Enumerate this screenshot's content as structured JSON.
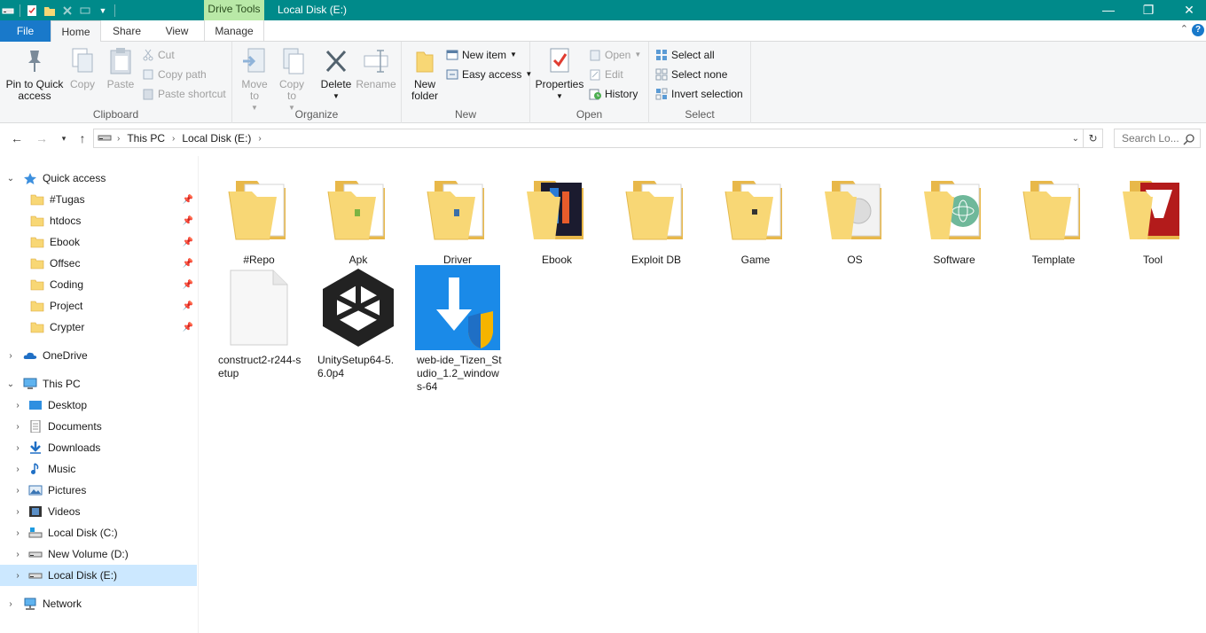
{
  "titlebar": {
    "context_tab": "Drive Tools",
    "title": "Local Disk (E:)",
    "controls": {
      "minimize": "—",
      "restore": "❐",
      "close": "✕"
    }
  },
  "tabs": {
    "file": "File",
    "home": "Home",
    "share": "Share",
    "view": "View",
    "manage": "Manage",
    "collapse": "⌃",
    "help": "?"
  },
  "ribbon": {
    "clipboard": {
      "label": "Clipboard",
      "pin": "Pin to Quick access",
      "copy": "Copy",
      "paste": "Paste",
      "cut": "Cut",
      "copy_path": "Copy path",
      "paste_shortcut": "Paste shortcut"
    },
    "organize": {
      "label": "Organize",
      "move_to": "Move to",
      "copy_to": "Copy to",
      "delete": "Delete",
      "rename": "Rename"
    },
    "new": {
      "label": "New",
      "new_folder": "New folder",
      "new_item": "New item",
      "easy_access": "Easy access"
    },
    "open": {
      "label": "Open",
      "properties": "Properties",
      "open": "Open",
      "edit": "Edit",
      "history": "History"
    },
    "select": {
      "label": "Select",
      "select_all": "Select all",
      "select_none": "Select none",
      "invert_selection": "Invert selection"
    }
  },
  "address": {
    "crumbs": [
      "This PC",
      "Local Disk (E:)"
    ],
    "search_placeholder": "Search Lo..."
  },
  "sidebar": {
    "quick_access": "Quick access",
    "pinned": [
      "#Tugas",
      "htdocs",
      "Ebook",
      "Offsec",
      "Coding",
      "Project",
      "Crypter"
    ],
    "onedrive": "OneDrive",
    "this_pc": "This PC",
    "pc_items": [
      "Desktop",
      "Documents",
      "Downloads",
      "Music",
      "Pictures",
      "Videos",
      "Local Disk (C:)",
      "New Volume (D:)",
      "Local Disk (E:)"
    ],
    "network": "Network"
  },
  "folders": [
    "#Repo",
    "Apk",
    "Driver",
    "Ebook",
    "Exploit DB",
    "Game",
    "OS",
    "Software",
    "Template",
    "Tool"
  ],
  "files": [
    "construct2-r244-setup",
    "UnitySetup64-5.6.0p4",
    "web-ide_Tizen_Studio_1.2_windows-64"
  ],
  "colors": {
    "titlebar": "#008a8a",
    "file_tab": "#1979ca",
    "drive_tools": "#b9e9a7",
    "selection": "#cce8ff",
    "folder": "#f8d775"
  }
}
